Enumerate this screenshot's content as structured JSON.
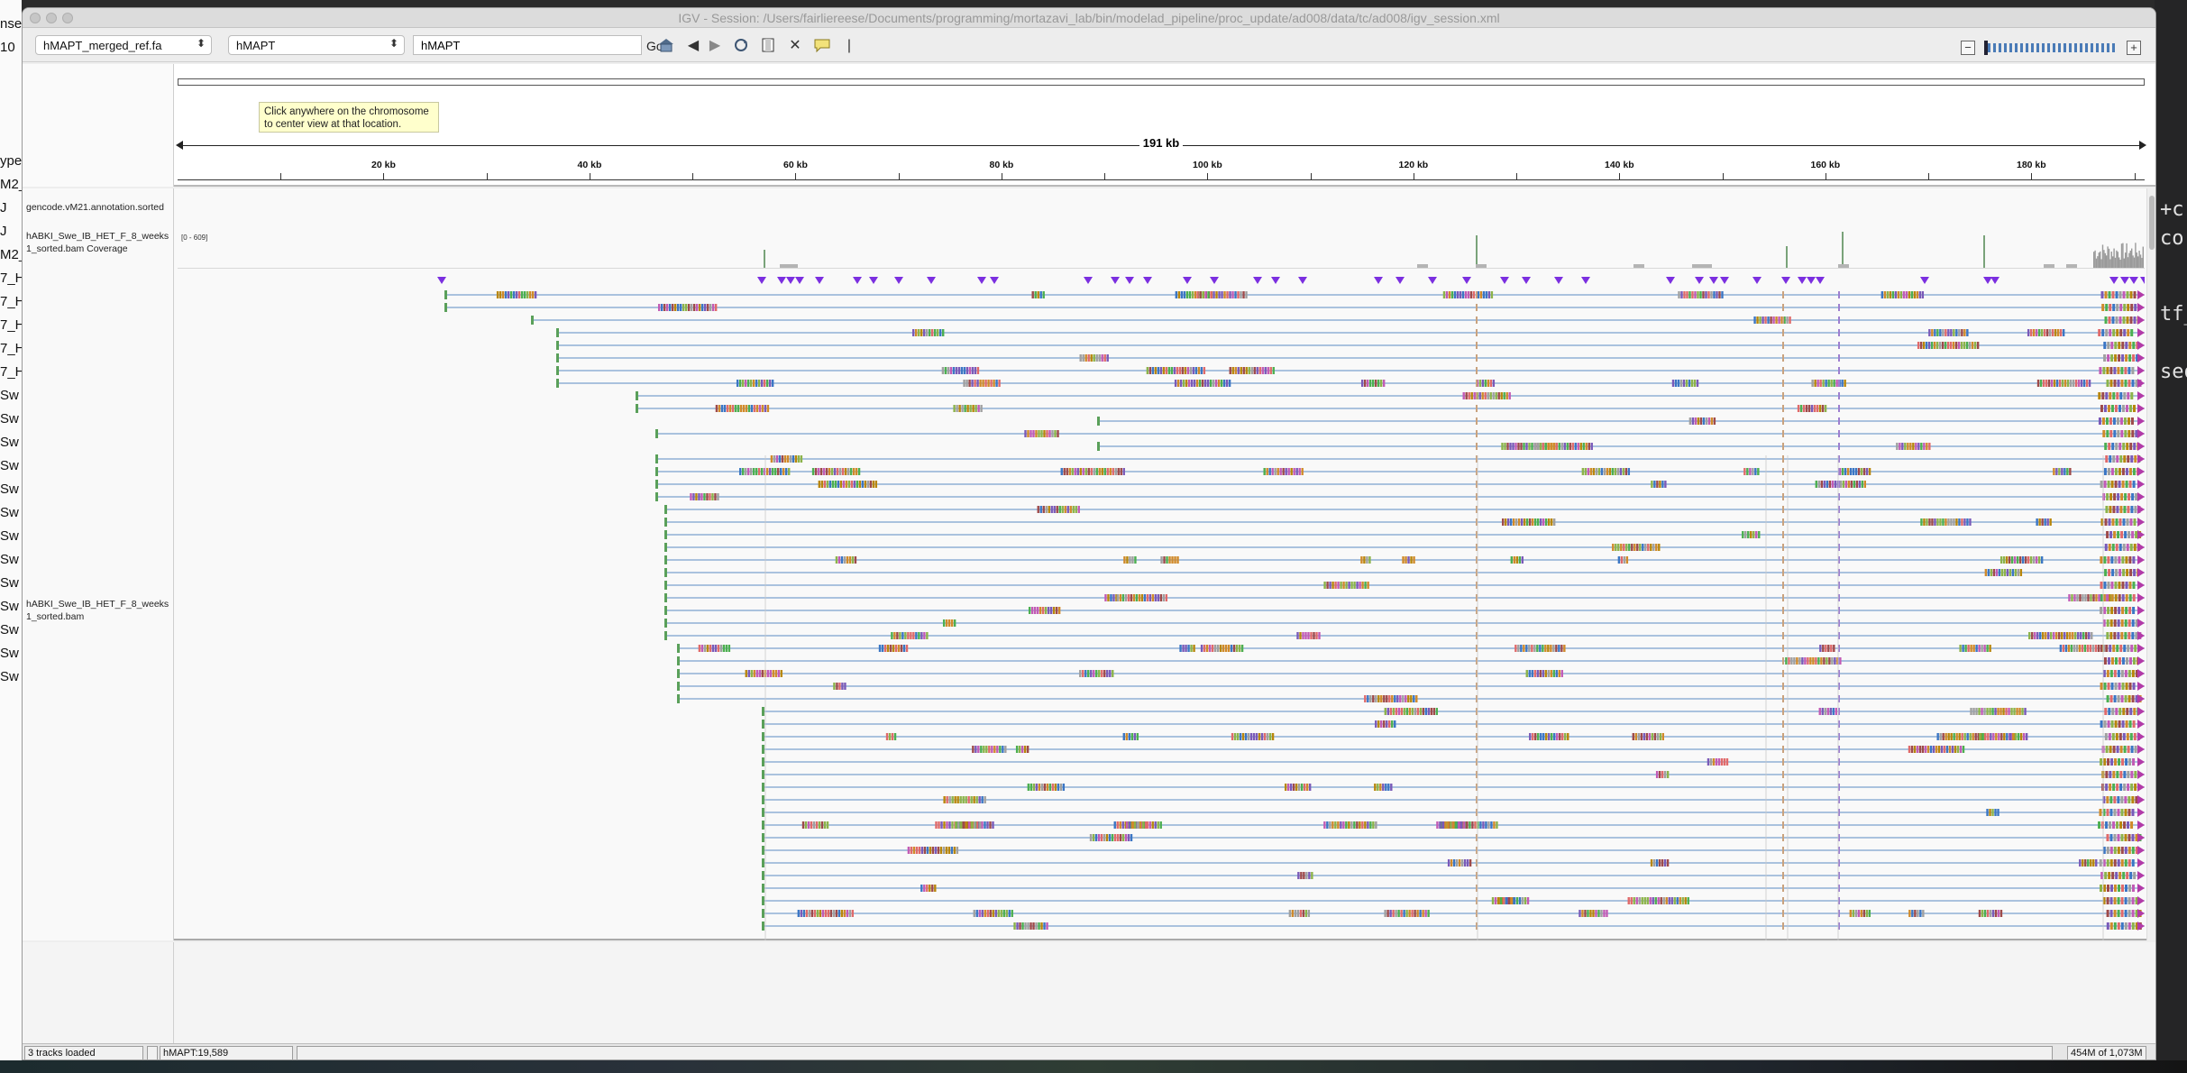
{
  "window": {
    "title": "IGV - Session: /Users/fairliereese/Documents/programming/mortazavi_lab/bin/modelad_pipeline/proc_update/ad008/data/tc/ad008/igv_session.xml"
  },
  "toolbar": {
    "genome_select": "hMAPT_merged_ref.fa",
    "chrom_select": "hMAPT",
    "locus_value": "hMAPT",
    "go_label": "Go",
    "icons": [
      "home-icon",
      "back-icon",
      "forward-icon",
      "refresh-icon",
      "roi-icon",
      "resize-icon",
      "popup-text-icon",
      "ruler-bar-icon"
    ]
  },
  "ruler": {
    "tooltip_line1": "Click anywhere on the chromosome",
    "tooltip_line2": "to center view at that location.",
    "span_label": "191 kb",
    "ticks": [
      "20 kb",
      "40 kb",
      "60 kb",
      "80 kb",
      "100 kb",
      "120 kb",
      "140 kb",
      "160 kb",
      "180 kb"
    ],
    "tick_values_kb": [
      20,
      40,
      60,
      80,
      100,
      120,
      140,
      160,
      180
    ],
    "total_kb": 191
  },
  "tracks": {
    "annotation_name": "gencode.vM21.annotation.sorted",
    "coverage_name_line1": "hABKI_Swe_IB_HET_F_8_weeks",
    "coverage_name_line2": "1_sorted.bam Coverage",
    "coverage_range": "[0 - 609]",
    "alignment_name_line1": "hABKI_Swe_IB_HET_F_8_weeks",
    "alignment_name_line2": "1_sorted.bam"
  },
  "status": {
    "tracks_loaded": "3 tracks loaded",
    "position": "hMAPT:19,589",
    "memory": "454M of 1,073M"
  },
  "background": {
    "left_text": [
      "nse",
      "10",
      "ype",
      "M2_",
      "J",
      "J",
      "M2_",
      "7_H",
      "7_H",
      "7_H",
      "7_H",
      "7_H",
      "Sw",
      "Sw",
      "Sw",
      "Sw",
      "Sw",
      "Sw",
      "Sw",
      "Sw",
      "Sw",
      "Sw",
      "Sw",
      "Sw",
      "Sw"
    ],
    "right_text": [
      "+c",
      "co",
      "tf_",
      "seq"
    ]
  },
  "colors": {
    "read_line": "#5b8cc4",
    "insertion": "#7b2fe0",
    "coverage": "#9a9a9a"
  }
}
